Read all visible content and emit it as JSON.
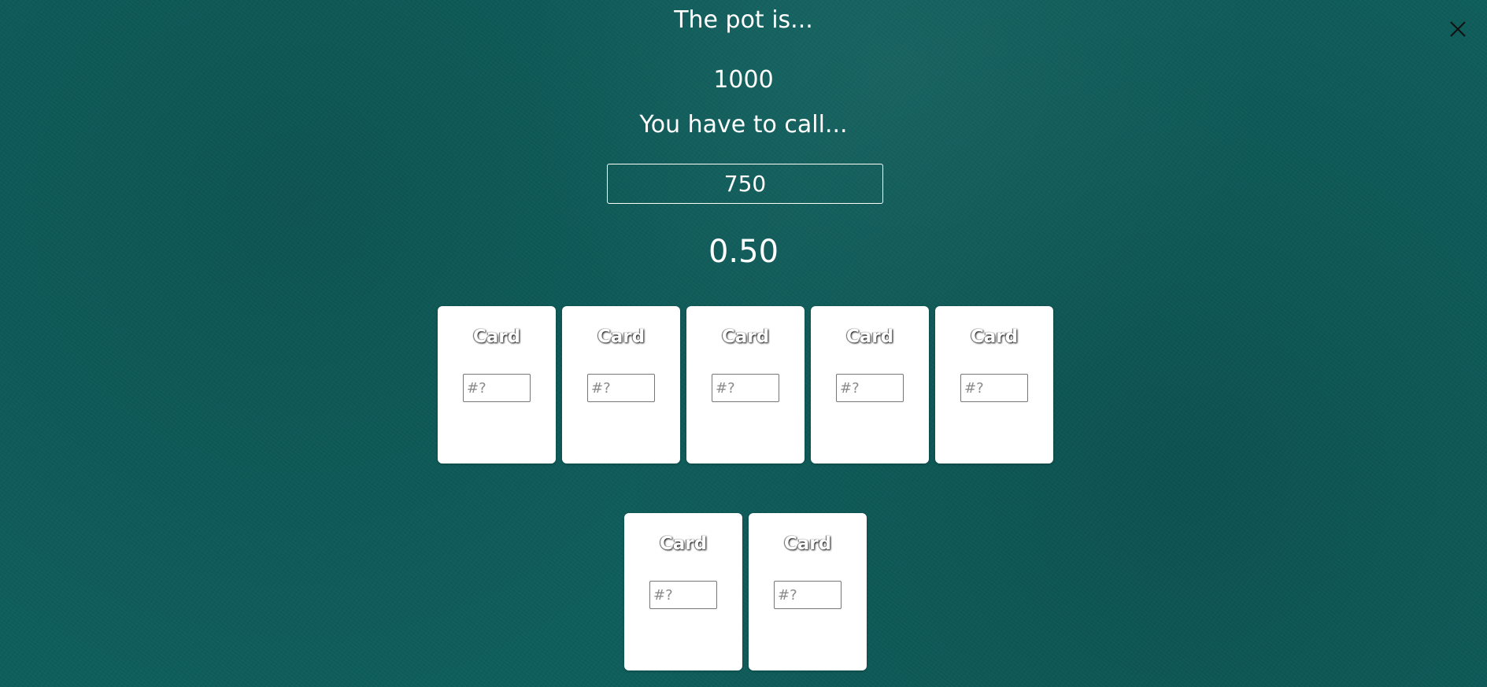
{
  "header": {
    "pot_label": "The pot is...",
    "pot_value": "1000",
    "call_label": "You have to call...",
    "call_value": "750",
    "odds_value": "0.50"
  },
  "community_cards": [
    {
      "label": "Card",
      "placeholder": "#?",
      "value": ""
    },
    {
      "label": "Card",
      "placeholder": "#?",
      "value": ""
    },
    {
      "label": "Card",
      "placeholder": "#?",
      "value": ""
    },
    {
      "label": "Card",
      "placeholder": "#?",
      "value": ""
    },
    {
      "label": "Card",
      "placeholder": "#?",
      "value": ""
    }
  ],
  "hole_cards": [
    {
      "label": "Card",
      "placeholder": "#?",
      "value": ""
    },
    {
      "label": "Card",
      "placeholder": "#?",
      "value": ""
    }
  ],
  "close": {
    "icon": "close-icon"
  },
  "colors": {
    "felt": "#0f5e5c",
    "card": "#ffffff",
    "text": "#ffffff"
  }
}
